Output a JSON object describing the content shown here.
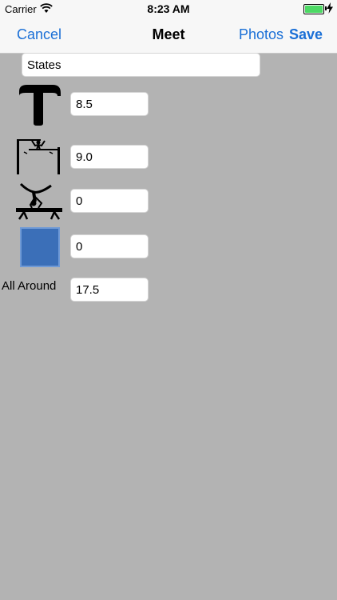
{
  "status_bar": {
    "carrier": "Carrier",
    "time": "8:23 AM",
    "battery_color": "#4cd964"
  },
  "nav": {
    "cancel": "Cancel",
    "title": "Meet",
    "photos": "Photos",
    "save": "Save",
    "tint": "#1a6fd6"
  },
  "meet_name": "States",
  "events": [
    {
      "icon": "vault-icon",
      "score": "8.5"
    },
    {
      "icon": "uneven-bars-icon",
      "score": "9.0"
    },
    {
      "icon": "balance-beam-icon",
      "score": "0"
    },
    {
      "icon": "floor-icon",
      "score": "0"
    }
  ],
  "all_around": {
    "label": "All Around",
    "score": "17.5"
  },
  "colors": {
    "background": "#b3b3b3",
    "floor_fill": "#3b6fb8"
  }
}
